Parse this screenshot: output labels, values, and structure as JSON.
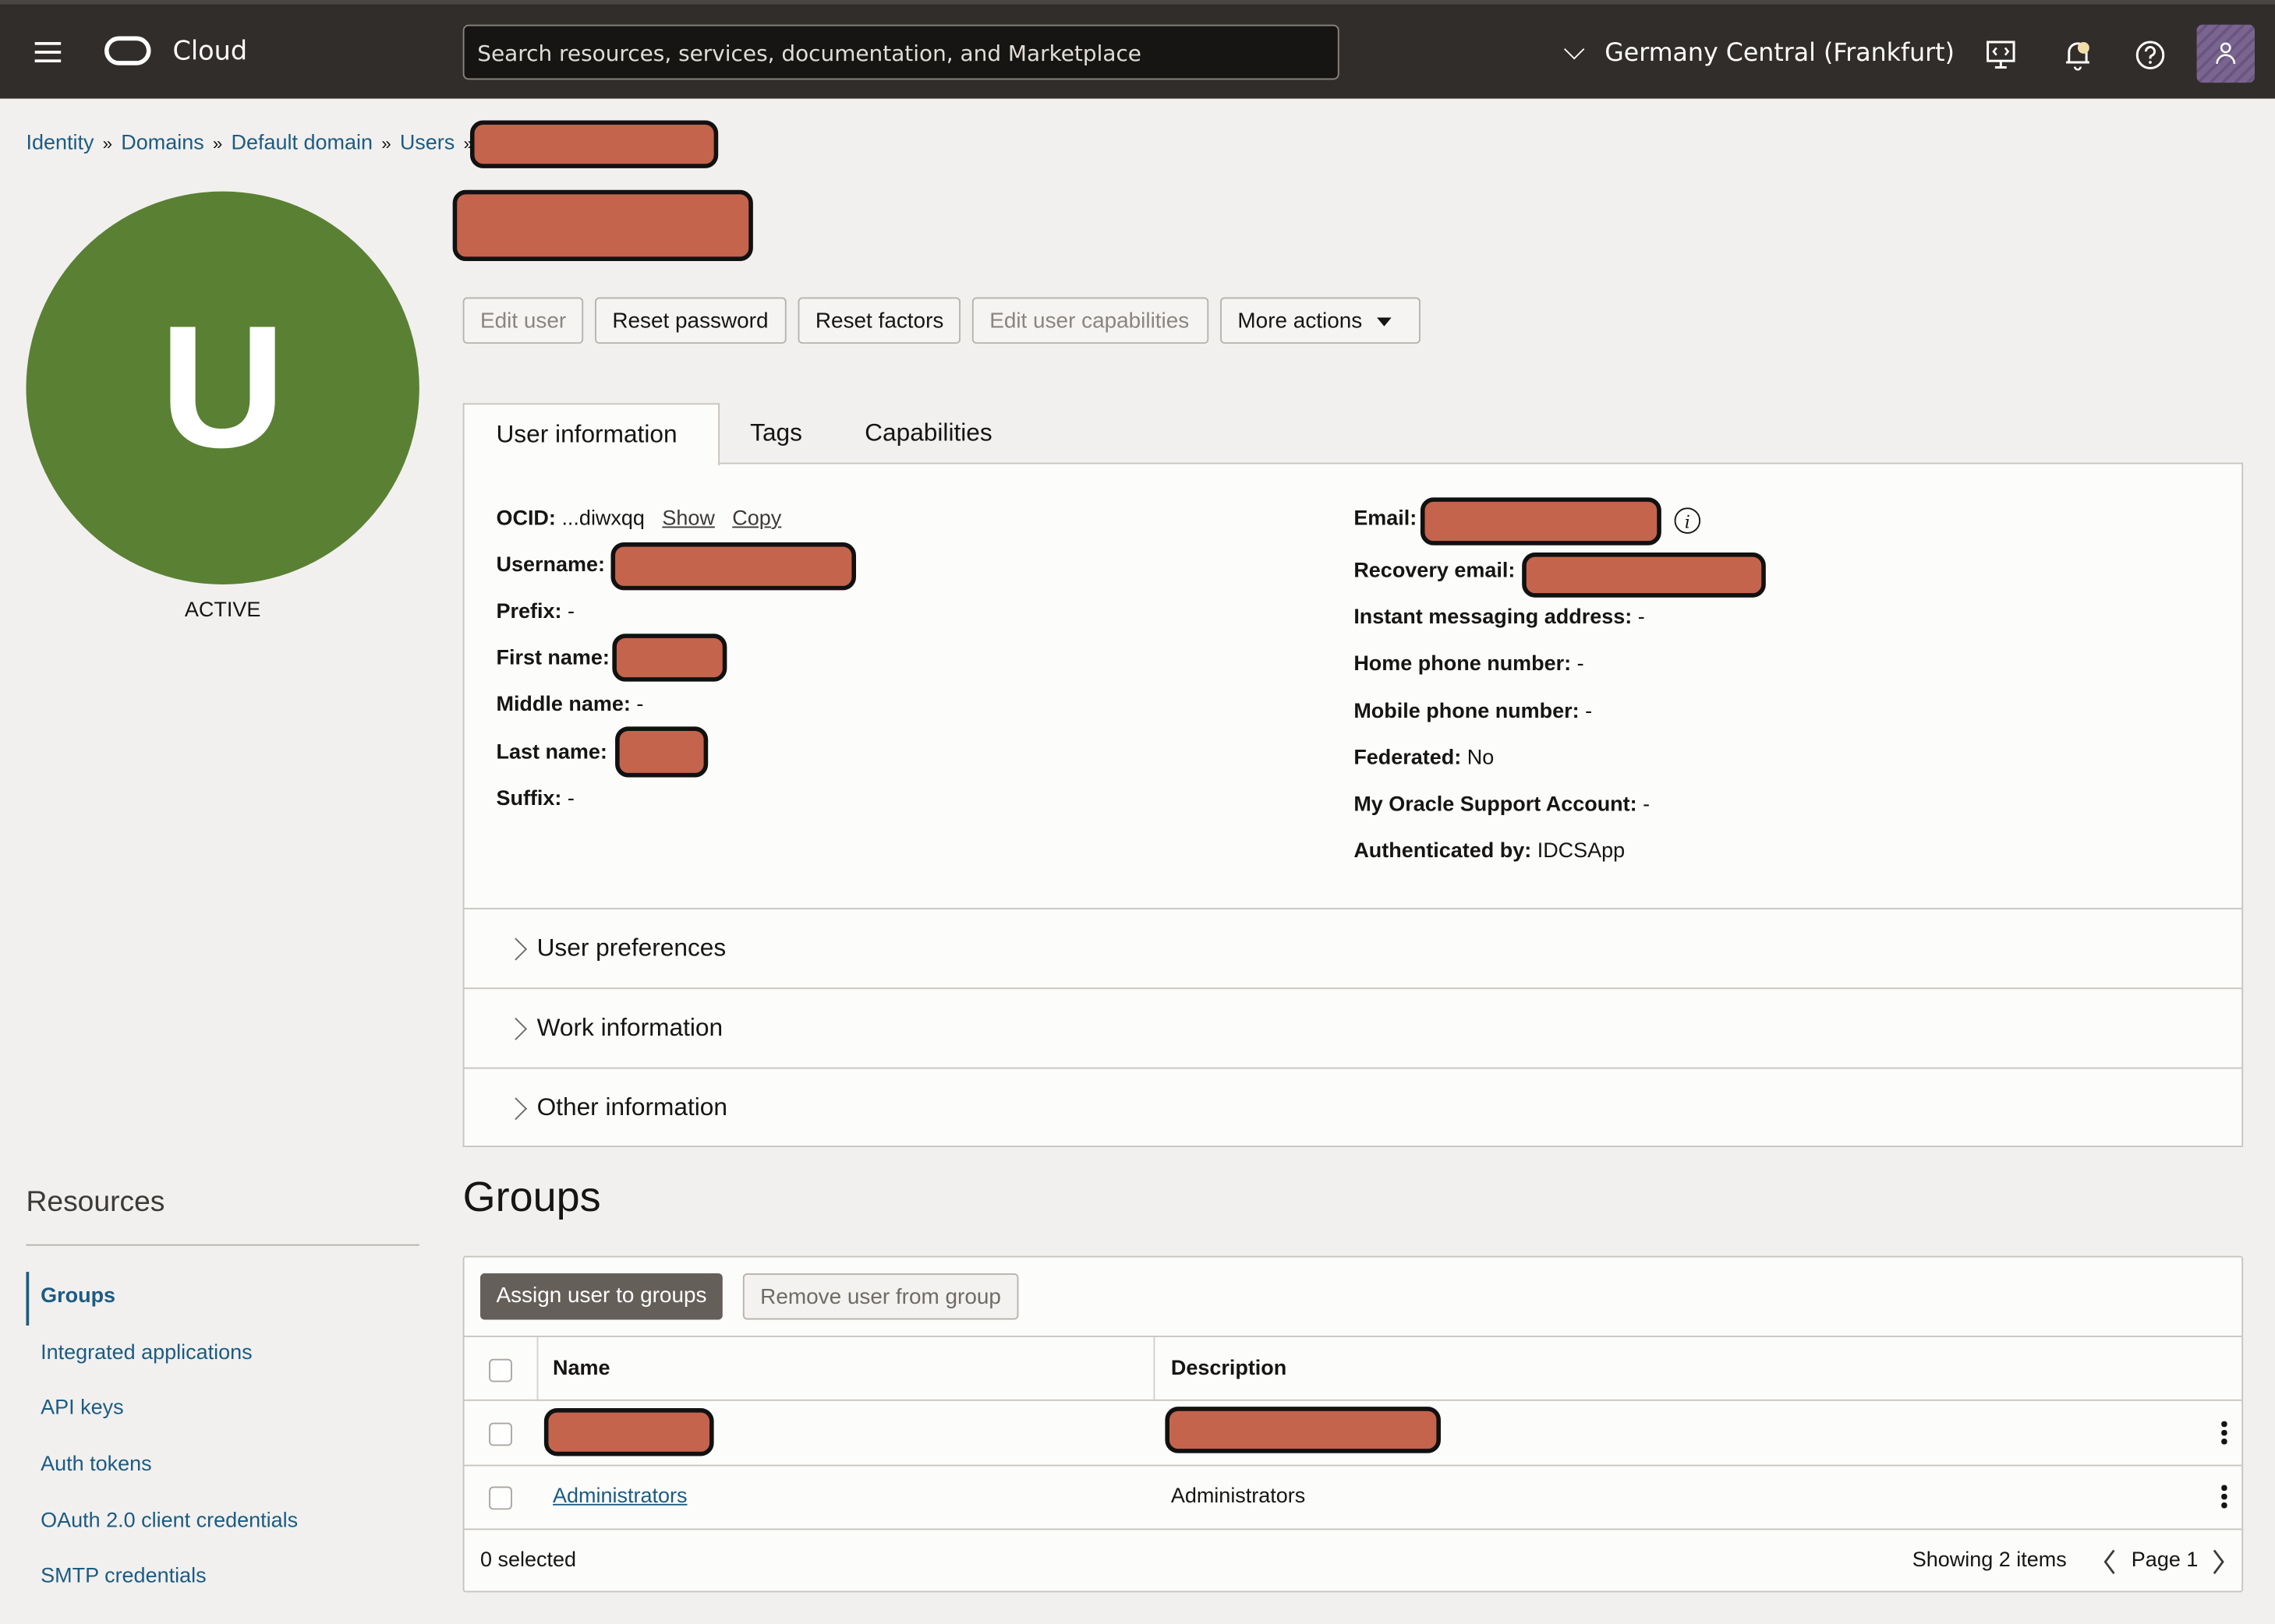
{
  "topbar": {
    "brand": "Cloud",
    "search_placeholder": "Search resources, services, documentation, and Marketplace",
    "region": "Germany Central (Frankfurt)",
    "icons": [
      "menu-icon",
      "oracle-logo-icon",
      "chevron-down-icon",
      "cloud-shell-icon",
      "bell-icon",
      "help-icon",
      "profile-icon"
    ]
  },
  "breadcrumb": [
    "Identity",
    "Domains",
    "Default domain",
    "Users"
  ],
  "breadcrumb_separator": "»",
  "avatar": {
    "initial": "U",
    "status": "ACTIVE",
    "color": "#5a8034"
  },
  "actions": {
    "edit_user": "Edit user",
    "reset_password": "Reset password",
    "reset_factors": "Reset factors",
    "edit_capabilities": "Edit user capabilities",
    "more_actions": "More actions"
  },
  "tabs": [
    "User information",
    "Tags",
    "Capabilities"
  ],
  "user_info": {
    "ocid_label": "OCID:",
    "ocid_value": "...diwxqq",
    "show_link": "Show",
    "copy_link": "Copy",
    "username_label": "Username:",
    "prefix_label": "Prefix:",
    "prefix_value": "-",
    "first_name_label": "First name:",
    "middle_name_label": "Middle name:",
    "middle_name_value": "-",
    "last_name_label": "Last name:",
    "suffix_label": "Suffix:",
    "suffix_value": "-",
    "email_label": "Email:",
    "recovery_email_label": "Recovery email:",
    "im_label": "Instant messaging address:",
    "im_value": "-",
    "home_phone_label": "Home phone number:",
    "home_phone_value": "-",
    "mobile_phone_label": "Mobile phone number:",
    "mobile_phone_value": "-",
    "federated_label": "Federated:",
    "federated_value": "No",
    "mos_label": "My Oracle Support Account:",
    "mos_value": "-",
    "auth_label": "Authenticated by:",
    "auth_value": "IDCSApp"
  },
  "accordions": [
    "User preferences",
    "Work information",
    "Other information"
  ],
  "resources": {
    "title": "Resources",
    "items": [
      "Groups",
      "Integrated applications",
      "API keys",
      "Auth tokens",
      "OAuth 2.0 client credentials",
      "SMTP credentials"
    ],
    "active": "Groups"
  },
  "groups": {
    "title": "Groups",
    "assign_button": "Assign user to groups",
    "remove_button": "Remove user from group",
    "columns": [
      "Name",
      "Description"
    ],
    "rows": [
      {
        "name": "[redacted]",
        "description": "[redacted]"
      },
      {
        "name": "Administrators",
        "description": "Administrators"
      }
    ],
    "selected": "0 selected",
    "showing": "Showing 2 items",
    "page": "Page 1"
  },
  "colors": {
    "link": "#1d5b82",
    "topbar": "#312d2a",
    "redaction": "#c4644c"
  }
}
